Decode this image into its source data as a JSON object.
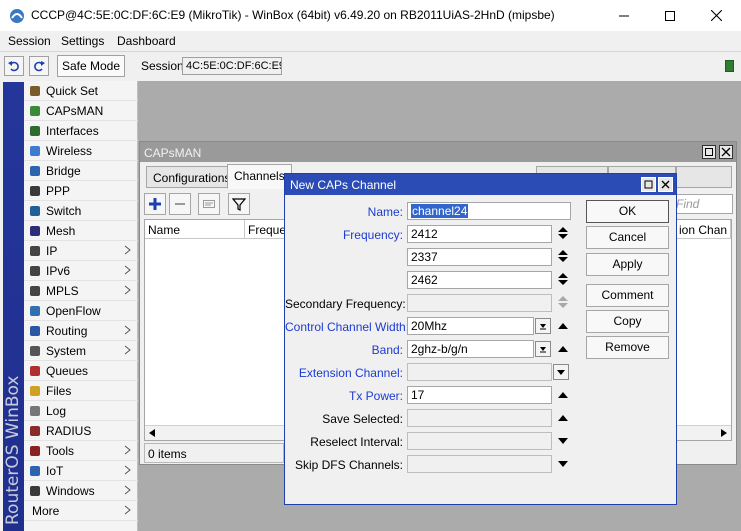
{
  "window": {
    "title": "CCCP@4C:5E:0C:DF:6C:E9 (MikroTik) - WinBox (64bit) v6.49.20 on RB2011UiAS-2HnD (mipsbe)",
    "icon": "winbox-icon"
  },
  "menu": [
    "Session",
    "Settings",
    "Dashboard"
  ],
  "toolbar": {
    "undo_icon": "undo-icon",
    "redo_icon": "redo-icon",
    "safe_mode": "Safe Mode",
    "session_label": "Session:",
    "session_value": "4C:5E:0C:DF:6C:E9",
    "status_color": "#2e7d32"
  },
  "brand": "RouterOS WinBox",
  "sidebar": {
    "items": [
      {
        "label": "Quick Set",
        "icon": "wand-icon",
        "submenu": false
      },
      {
        "label": "CAPsMAN",
        "icon": "antenna-icon",
        "submenu": false
      },
      {
        "label": "Interfaces",
        "icon": "ethernet-icon",
        "submenu": false
      },
      {
        "label": "Wireless",
        "icon": "wireless-icon",
        "submenu": false
      },
      {
        "label": "Bridge",
        "icon": "bridge-icon",
        "submenu": false
      },
      {
        "label": "PPP",
        "icon": "ppp-icon",
        "submenu": false
      },
      {
        "label": "Switch",
        "icon": "switch-icon",
        "submenu": false
      },
      {
        "label": "Mesh",
        "icon": "mesh-icon",
        "submenu": false
      },
      {
        "label": "IP",
        "icon": "ip-icon",
        "submenu": true
      },
      {
        "label": "IPv6",
        "icon": "ipv6-icon",
        "submenu": true
      },
      {
        "label": "MPLS",
        "icon": "mpls-icon",
        "submenu": true
      },
      {
        "label": "OpenFlow",
        "icon": "openflow-icon",
        "submenu": false
      },
      {
        "label": "Routing",
        "icon": "routing-icon",
        "submenu": true
      },
      {
        "label": "System",
        "icon": "gear-icon",
        "submenu": true
      },
      {
        "label": "Queues",
        "icon": "queues-icon",
        "submenu": false
      },
      {
        "label": "Files",
        "icon": "folder-icon",
        "submenu": false
      },
      {
        "label": "Log",
        "icon": "log-icon",
        "submenu": false
      },
      {
        "label": "RADIUS",
        "icon": "radius-icon",
        "submenu": false
      },
      {
        "label": "Tools",
        "icon": "tools-icon",
        "submenu": true
      },
      {
        "label": "IoT",
        "icon": "iot-icon",
        "submenu": true
      },
      {
        "label": "Windows",
        "icon": "windows-icon",
        "submenu": true
      },
      {
        "label": "More",
        "icon": "",
        "submenu": true
      }
    ]
  },
  "capsman": {
    "title": "CAPsMAN",
    "tabs": [
      "Configurations",
      "Channels"
    ],
    "active_tab": "Channels",
    "find_placeholder": "Find",
    "columns": [
      "Name",
      "Frequen",
      "ion Chan"
    ],
    "item_count": "0 items"
  },
  "dialog": {
    "title": "New CAPs Channel",
    "fields": {
      "name": {
        "label": "Name:",
        "value": "channel24"
      },
      "frequency": {
        "label": "Frequency:",
        "values": [
          "2412",
          "2337",
          "2462"
        ]
      },
      "secondary_frequency": {
        "label": "Secondary Frequency:",
        "value": ""
      },
      "control_channel_width": {
        "label": "Control Channel Width:",
        "value": "20Mhz"
      },
      "band": {
        "label": "Band:",
        "value": "2ghz-b/g/n"
      },
      "extension_channel": {
        "label": "Extension Channel:",
        "value": ""
      },
      "tx_power": {
        "label": "Tx Power:",
        "value": "17"
      },
      "save_selected": {
        "label": "Save Selected:",
        "value": ""
      },
      "reselect_interval": {
        "label": "Reselect Interval:",
        "value": ""
      },
      "skip_dfs_channels": {
        "label": "Skip DFS Channels:",
        "value": ""
      }
    },
    "buttons": {
      "ok": "OK",
      "cancel": "Cancel",
      "apply": "Apply",
      "comment": "Comment",
      "copy": "Copy",
      "remove": "Remove"
    }
  }
}
